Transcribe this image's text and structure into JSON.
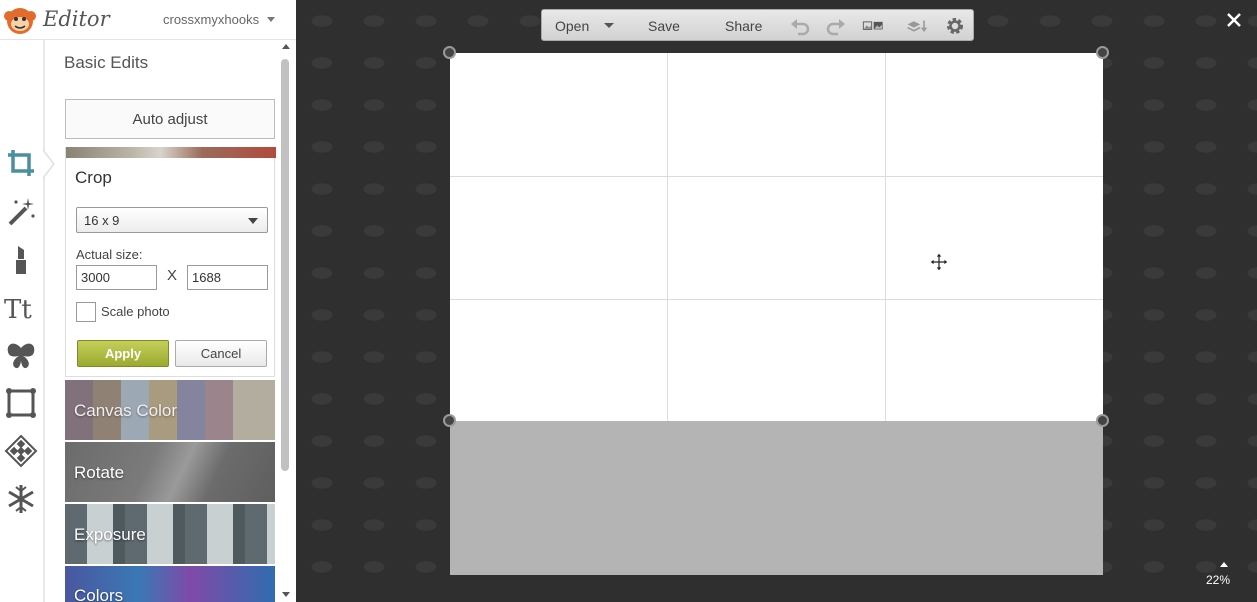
{
  "app": {
    "name": "Editor",
    "user": "crossxmyxhooks"
  },
  "sidebar": {
    "rail_icons": [
      "crop-icon",
      "magic-wand-icon",
      "lipstick-icon",
      "text-icon",
      "butterfly-icon",
      "frame-icon",
      "texture-icon",
      "snowflake-icon"
    ],
    "panel_title": "Basic Edits",
    "auto_adjust": "Auto adjust",
    "crop": {
      "title": "Crop",
      "ratio": "16 x 9",
      "actual_size_label": "Actual size:",
      "width": "3000",
      "separator": "X",
      "height": "1688",
      "scale_label": "Scale photo",
      "scale_checked": false,
      "apply": "Apply",
      "cancel": "Cancel"
    },
    "tools": [
      "Canvas Color",
      "Rotate",
      "Exposure",
      "Colors"
    ]
  },
  "toolbar": {
    "open": "Open",
    "save": "Save",
    "share": "Share",
    "icons": [
      "undo-icon",
      "redo-icon",
      "compare-icon",
      "layers-icon",
      "settings-icon"
    ]
  },
  "workspace": {
    "zoom": "22%"
  },
  "colors": {
    "accent": "#4a8fa0",
    "apply": "#a9b63b",
    "background": "#2f2f2f"
  }
}
